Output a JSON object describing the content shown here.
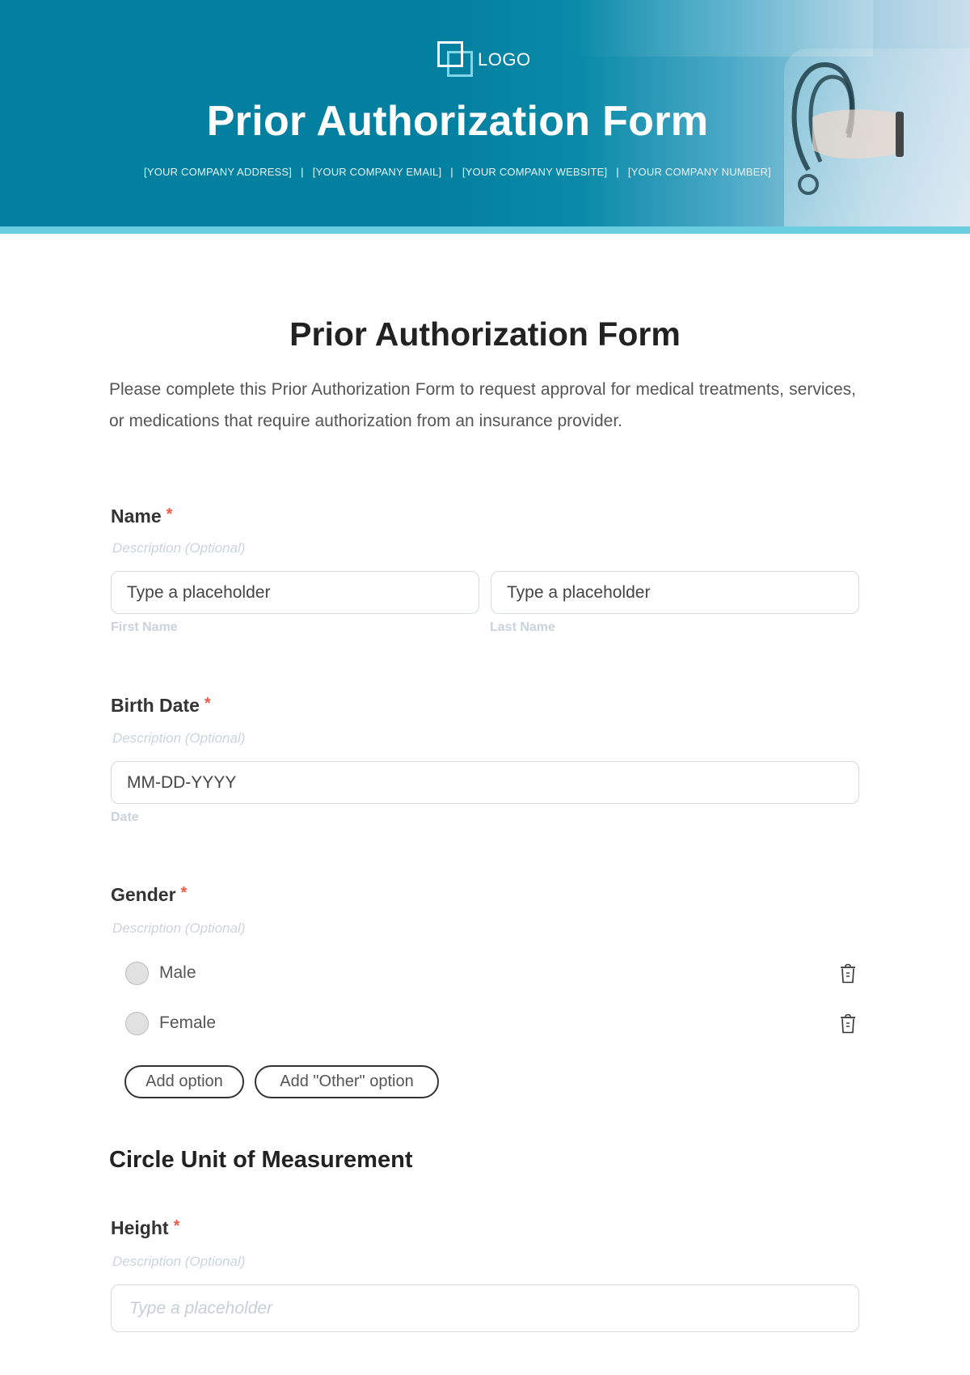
{
  "header": {
    "logo_text": "LOGO",
    "title": "Prior Authorization Form",
    "contacts": [
      "[YOUR COMPANY ADDRESS]",
      "[YOUR COMPANY EMAIL]",
      "[YOUR COMPANY WEBSITE]",
      "[YOUR COMPANY NUMBER]"
    ],
    "separator": "|",
    "image": "doctor-holding-stethoscope",
    "colors": {
      "primary": "#037f9f",
      "stripe": "#6acde0"
    }
  },
  "form": {
    "title": "Prior Authorization Form",
    "intro": "Please complete this Prior Authorization Form to request approval for medical treatments, services, or medications that require authorization from an insurance provider.",
    "required_marker": "*",
    "required_color": "#f05a46",
    "fields": {
      "name": {
        "label": "Name",
        "description": "Description (Optional)",
        "first": {
          "placeholder": "Type a placeholder",
          "sublabel": "First Name"
        },
        "last": {
          "placeholder": "Type a placeholder",
          "sublabel": "Last Name"
        }
      },
      "birth_date": {
        "label": "Birth Date",
        "description": "Description (Optional)",
        "placeholder": "MM-DD-YYYY",
        "sublabel": "Date"
      },
      "gender": {
        "label": "Gender",
        "description": "Description (Optional)",
        "options": [
          {
            "label": "Male",
            "icon": "trash-icon"
          },
          {
            "label": "Female",
            "icon": "trash-icon"
          }
        ],
        "add_option_label": "Add option",
        "add_other_label": "Add \"Other\" option"
      }
    },
    "section": {
      "title": "Circle Unit of Measurement",
      "height": {
        "label": "Height",
        "description": "Description (Optional)",
        "placeholder": "Type a placeholder"
      }
    }
  }
}
